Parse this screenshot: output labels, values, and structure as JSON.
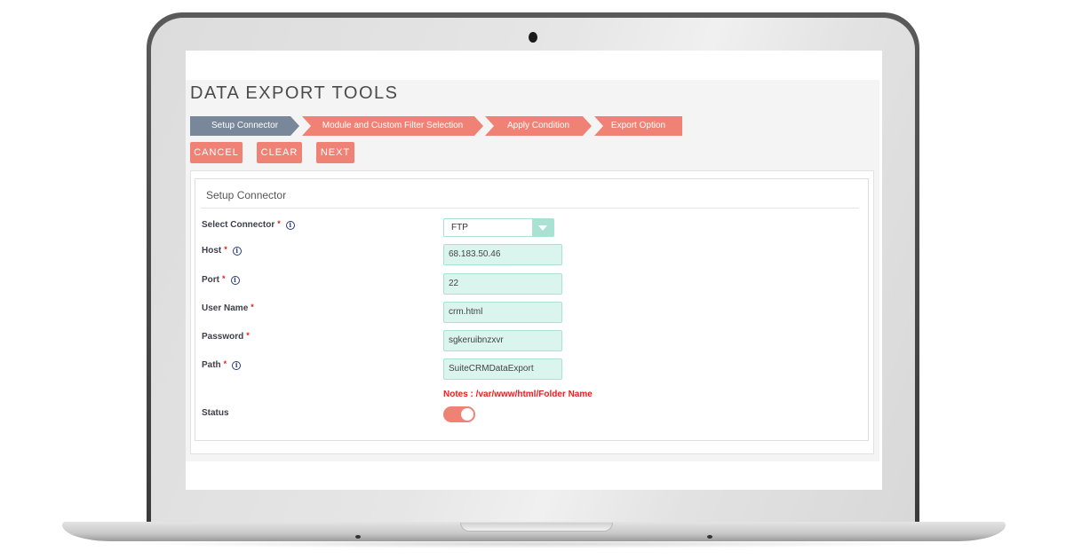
{
  "app": {
    "title": "DATA EXPORT TOOLS"
  },
  "steps": [
    {
      "label": "Setup Connector",
      "active": true
    },
    {
      "label": "Module and Custom Filter Selection",
      "active": false
    },
    {
      "label": "Apply Condition",
      "active": false
    },
    {
      "label": "Export Option",
      "active": false
    }
  ],
  "toolbar": {
    "cancel_label": "CANCEL",
    "clear_label": "CLEAR",
    "next_label": "NEXT"
  },
  "panel": {
    "title": "Setup Connector",
    "required_marker": "*",
    "info_glyph": "i",
    "fields": {
      "connector": {
        "label": "Select Connector",
        "value": "FTP",
        "required": true,
        "info": true
      },
      "host": {
        "label": "Host",
        "value": "68.183.50.46",
        "required": true,
        "info": true
      },
      "port": {
        "label": "Port",
        "value": "22",
        "required": true,
        "info": true
      },
      "username": {
        "label": "User Name",
        "value": "crm.html",
        "required": true,
        "info": false
      },
      "password": {
        "label": "Password",
        "value": "sgkeruibnzxvr",
        "required": true,
        "info": false
      },
      "path": {
        "label": "Path",
        "value": "SuiteCRMDataExport",
        "required": true,
        "info": true
      },
      "status": {
        "label": "Status",
        "enabled": true
      }
    },
    "note": "Notes : /var/www/html/Folder Name"
  },
  "colors": {
    "accent": "#f08275",
    "active_step": "#78889a",
    "field_bg": "#d9f5ee",
    "field_border": "#a9e2d2",
    "note": "#ee1c1c"
  }
}
